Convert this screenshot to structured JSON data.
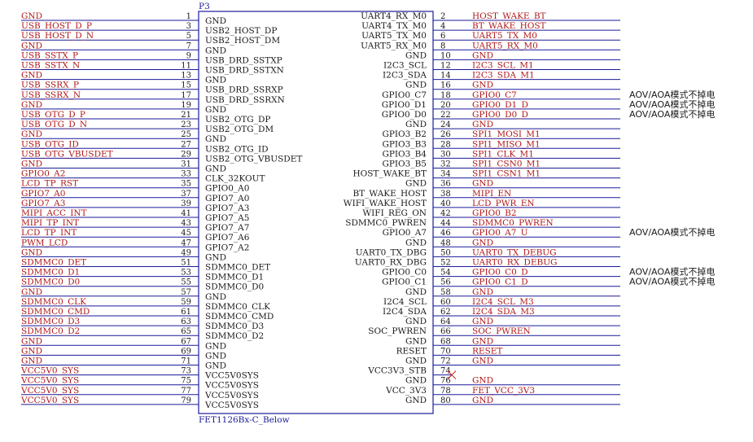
{
  "component": {
    "refdes": "P3",
    "part": "FET1126Bx-C_Below"
  },
  "left_pins": [
    {
      "num": "1",
      "name": "GND",
      "net": "GND"
    },
    {
      "num": "3",
      "name": "USB2_HOST_DP",
      "net": "USB_HOST_D_P"
    },
    {
      "num": "5",
      "name": "USB2_HOST_DM",
      "net": "USB_HOST_D_N"
    },
    {
      "num": "7",
      "name": "GND",
      "net": "GND"
    },
    {
      "num": "9",
      "name": "USB_DRD_SSTXP",
      "net": "USB_SSTX_P"
    },
    {
      "num": "11",
      "name": "USB_DRD_SSTXN",
      "net": "USB_SSTX_N"
    },
    {
      "num": "13",
      "name": "GND",
      "net": "GND"
    },
    {
      "num": "15",
      "name": "USB_DRD_SSRXP",
      "net": "USB_SSRX_P"
    },
    {
      "num": "17",
      "name": "USB_DRD_SSRXN",
      "net": "USB_SSRX_N"
    },
    {
      "num": "19",
      "name": "GND",
      "net": "GND"
    },
    {
      "num": "21",
      "name": "USB2_OTG_DP",
      "net": "USB_OTG_D_P"
    },
    {
      "num": "23",
      "name": "USB2_OTG_DM",
      "net": "USB_OTG_D_N"
    },
    {
      "num": "25",
      "name": "GND",
      "net": "GND"
    },
    {
      "num": "27",
      "name": "USB2_OTG_ID",
      "net": "USB_OTG_ID"
    },
    {
      "num": "29",
      "name": "USB2_OTG_VBUSDET",
      "net": "USB_OTG_VBUSDET"
    },
    {
      "num": "31",
      "name": "GND",
      "net": "GND"
    },
    {
      "num": "33",
      "name": "CLK_32KOUT",
      "net": "GPIO0_A2"
    },
    {
      "num": "35",
      "name": "GPIO0_A0",
      "net": "LCD_TP_RST"
    },
    {
      "num": "37",
      "name": "GPIO7_A0",
      "net": "GPIO7_A0"
    },
    {
      "num": "39",
      "name": "GPIO7_A3",
      "net": "GPIO7_A3"
    },
    {
      "num": "41",
      "name": "GPIO7_A5",
      "net": "MIPI_ACC_INT"
    },
    {
      "num": "43",
      "name": "GPIO7_A7",
      "net": "MIPI_TP_INT"
    },
    {
      "num": "45",
      "name": "GPIO7_A6",
      "net": "LCD_TP_INT"
    },
    {
      "num": "47",
      "name": "GPIO7_A2",
      "net": "PWM_LCD"
    },
    {
      "num": "49",
      "name": "GND",
      "net": "GND"
    },
    {
      "num": "51",
      "name": "SDMMC0_DET",
      "net": "SDMMC0_DET"
    },
    {
      "num": "53",
      "name": "SDMMC0_D1",
      "net": "SDMMC0_D1"
    },
    {
      "num": "55",
      "name": "SDMMC0_D0",
      "net": "SDMMC0_D0"
    },
    {
      "num": "57",
      "name": "GND",
      "net": "GND"
    },
    {
      "num": "59",
      "name": "SDMMC0_CLK",
      "net": "SDMMC0_CLK"
    },
    {
      "num": "61",
      "name": "SDMMC0_CMD",
      "net": "SDMMC0_CMD"
    },
    {
      "num": "63",
      "name": "SDMMC0_D3",
      "net": "SDMMC0_D3"
    },
    {
      "num": "65",
      "name": "SDMMC0_D2",
      "net": "SDMMC0_D2"
    },
    {
      "num": "67",
      "name": "GND",
      "net": "GND"
    },
    {
      "num": "69",
      "name": "GND",
      "net": "GND"
    },
    {
      "num": "71",
      "name": "GND",
      "net": "GND"
    },
    {
      "num": "73",
      "name": "VCC5V0SYS",
      "net": "VCC5V0_SYS"
    },
    {
      "num": "75",
      "name": "VCC5V0SYS",
      "net": "VCC5V0_SYS"
    },
    {
      "num": "77",
      "name": "VCC5V0SYS",
      "net": "VCC5V0_SYS"
    },
    {
      "num": "79",
      "name": "VCC5V0SYS",
      "net": "VCC5V0_SYS"
    }
  ],
  "right_pins": [
    {
      "num": "2",
      "name": "UART4_RX_M0",
      "net": "HOST_WAKE_BT",
      "note": ""
    },
    {
      "num": "4",
      "name": "UART4_TX_M0",
      "net": "BT_WAKE_HOST",
      "note": ""
    },
    {
      "num": "6",
      "name": "UART5_TX_M0",
      "net": "UART5_TX_M0",
      "note": ""
    },
    {
      "num": "8",
      "name": "UART5_RX_M0",
      "net": "UART5_RX_M0",
      "note": ""
    },
    {
      "num": "10",
      "name": "GND",
      "net": "GND",
      "note": ""
    },
    {
      "num": "12",
      "name": "I2C3_SCL",
      "net": "I2C3_SCL_M1",
      "note": ""
    },
    {
      "num": "14",
      "name": "I2C3_SDA",
      "net": "I2C3_SDA_M1",
      "note": ""
    },
    {
      "num": "16",
      "name": "GND",
      "net": "GND",
      "note": ""
    },
    {
      "num": "18",
      "name": "GPIO0_C7",
      "net": "GPIO0_C7",
      "note": "AOV/AOA模式不掉电"
    },
    {
      "num": "20",
      "name": "GPIO0_D1",
      "net": "GPIO0_D1_D",
      "note": "AOV/AOA模式不掉电"
    },
    {
      "num": "22",
      "name": "GPIO0_D0",
      "net": "GPIO0_D0_D",
      "note": "AOV/AOA模式不掉电"
    },
    {
      "num": "24",
      "name": "GND",
      "net": "GND",
      "note": ""
    },
    {
      "num": "26",
      "name": "GPIO3_B2",
      "net": "SPI1_MOSI_M1",
      "note": ""
    },
    {
      "num": "28",
      "name": "GPIO3_B3",
      "net": "SPI1_MISO_M1",
      "note": ""
    },
    {
      "num": "30",
      "name": "GPIO3_B4",
      "net": "SPI1_CLK_M1",
      "note": ""
    },
    {
      "num": "32",
      "name": "GPIO3_B5",
      "net": "SPI1_CSN0_M1",
      "note": ""
    },
    {
      "num": "34",
      "name": "HOST_WAKE_BT",
      "net": "SPI1_CSN1_M1",
      "note": ""
    },
    {
      "num": "36",
      "name": "GND",
      "net": "GND",
      "note": ""
    },
    {
      "num": "38",
      "name": "BT_WAKE_HOST",
      "net": "MIPI_EN",
      "note": ""
    },
    {
      "num": "40",
      "name": "WIFI_WAKE_HOST",
      "net": "LCD_PWR_EN",
      "note": ""
    },
    {
      "num": "42",
      "name": "WIFI_REG_ON",
      "net": "GPIO0_B2",
      "note": ""
    },
    {
      "num": "44",
      "name": "SDMMC0_PWREN",
      "net": "SDMMC0_PWREN",
      "note": ""
    },
    {
      "num": "46",
      "name": "GPIO0_A7",
      "net": "GPIO0_A7_U",
      "note": "AOV/AOA模式不掉电"
    },
    {
      "num": "48",
      "name": "GND",
      "net": "GND",
      "note": ""
    },
    {
      "num": "50",
      "name": "UART0_TX_DBG",
      "net": "UART0_TX_DEBUG",
      "note": ""
    },
    {
      "num": "52",
      "name": "UART0_RX_DBG",
      "net": "UART0_RX_DEBUG",
      "note": ""
    },
    {
      "num": "54",
      "name": "GPIO0_C0",
      "net": "GPIO0_C0_D",
      "note": "AOV/AOA模式不掉电"
    },
    {
      "num": "56",
      "name": "GPIO0_C1",
      "net": "GPIO0_C1_D",
      "note": "AOV/AOA模式不掉电"
    },
    {
      "num": "58",
      "name": "GND",
      "net": "GND",
      "note": ""
    },
    {
      "num": "60",
      "name": "I2C4_SCL",
      "net": "I2C4_SCL_M3",
      "note": ""
    },
    {
      "num": "62",
      "name": "I2C4_SDA",
      "net": "I2C4_SDA_M3",
      "note": ""
    },
    {
      "num": "64",
      "name": "GND",
      "net": "GND",
      "note": ""
    },
    {
      "num": "66",
      "name": "SOC_PWREN",
      "net": "SOC_PWREN",
      "note": ""
    },
    {
      "num": "68",
      "name": "GND",
      "net": "GND",
      "note": ""
    },
    {
      "num": "70",
      "name": "RESET",
      "net": "RESET",
      "note": ""
    },
    {
      "num": "72",
      "name": "GND",
      "net": "GND",
      "note": ""
    },
    {
      "num": "74",
      "name": "VCC3V3_STB",
      "net": "",
      "note": "",
      "nc": true
    },
    {
      "num": "76",
      "name": "GND",
      "net": "GND",
      "note": ""
    },
    {
      "num": "78",
      "name": "VCC_3V3",
      "net": "FET_VCC_3V3",
      "note": ""
    },
    {
      "num": "80",
      "name": "GND",
      "net": "GND",
      "note": ""
    }
  ]
}
